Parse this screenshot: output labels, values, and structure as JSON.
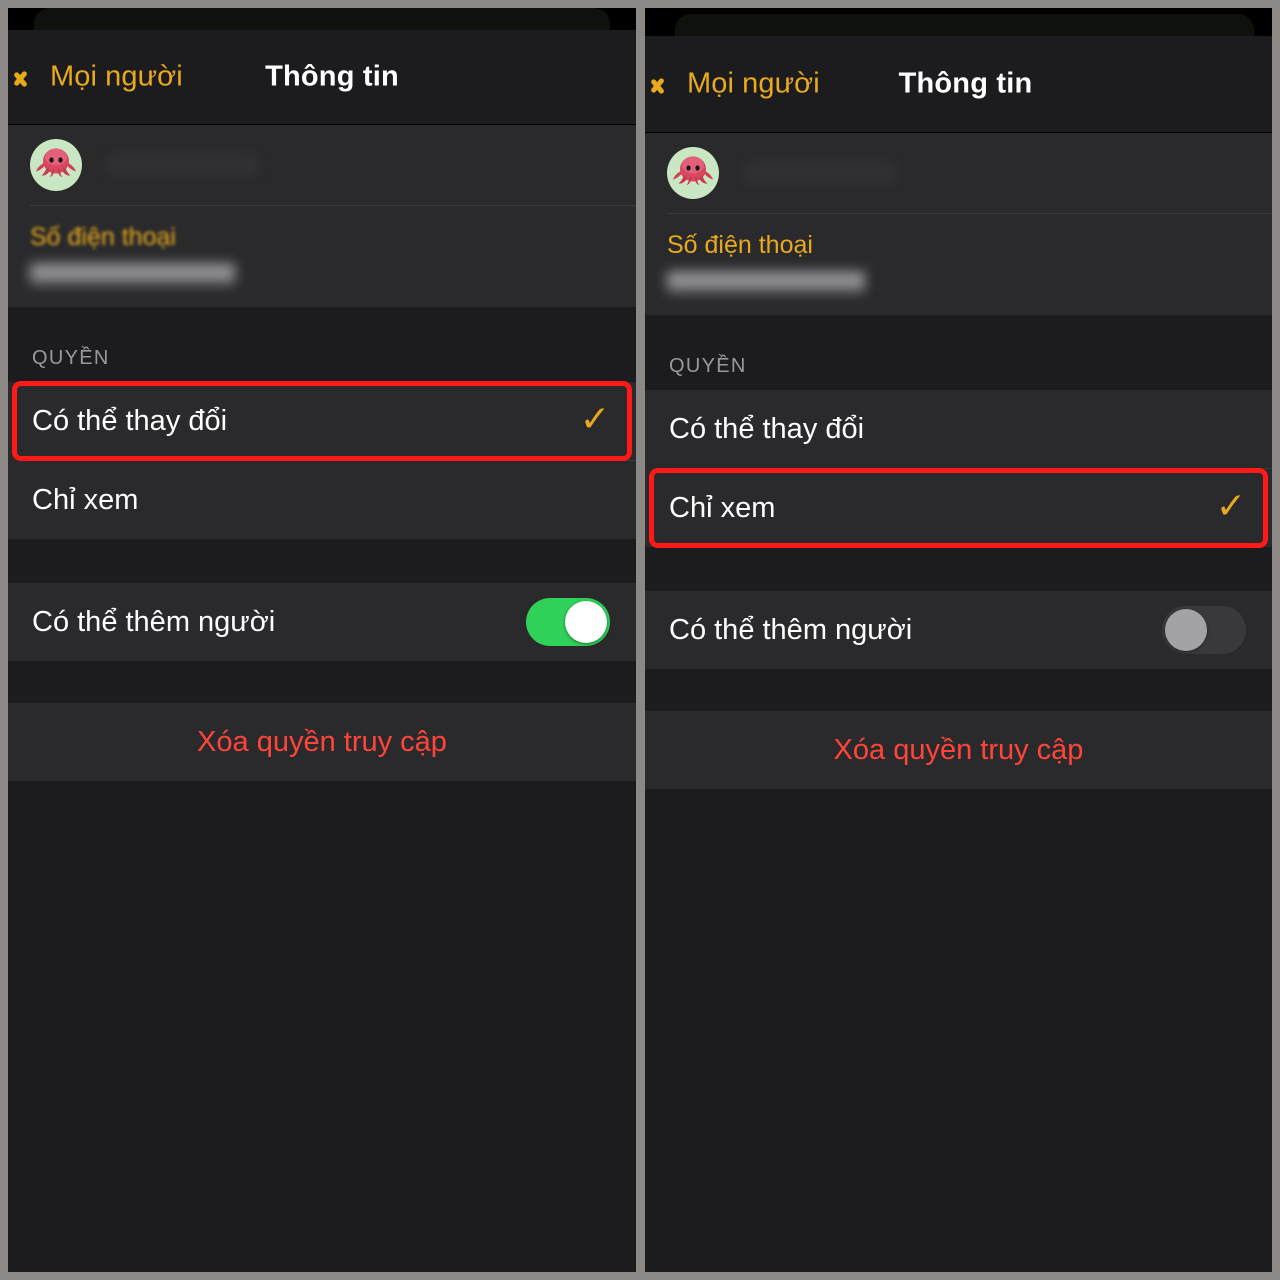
{
  "meta": {
    "background_color": "#8b8885",
    "panel_background": "#1c1c1e",
    "group_background": "#2a2a2c",
    "accent_color": "#e8a91d",
    "highlight_color": "#ff1a17",
    "destructive_color": "#ff453a",
    "toggle_on_color": "#30d158",
    "toggle_off_color": "#39393c"
  },
  "panels": [
    {
      "id": "left",
      "nav": {
        "back_label": "Mọi người",
        "back_icon": "chevron-left-icon",
        "title": "Thông tin"
      },
      "contact": {
        "avatar_icon": "octopus-avatar",
        "name_redacted": true,
        "phone_label": "Số điện thoại",
        "phone_value_redacted": true
      },
      "permissions": {
        "section_header": "QUYỀN",
        "options": [
          {
            "label": "Có thể thay đổi",
            "checked": true,
            "highlighted": true,
            "check_icon": "checkmark-icon"
          },
          {
            "label": "Chỉ xem",
            "checked": false,
            "highlighted": false,
            "check_icon": "checkmark-icon"
          }
        ]
      },
      "add_people": {
        "label": "Có thể thêm người",
        "toggle_state": "on"
      },
      "destructive": {
        "label": "Xóa quyền truy cập"
      }
    },
    {
      "id": "right",
      "nav": {
        "back_label": "Mọi người",
        "back_icon": "chevron-left-icon",
        "title": "Thông tin"
      },
      "contact": {
        "avatar_icon": "octopus-avatar",
        "name_redacted": true,
        "phone_label": "Số điện thoại",
        "phone_value_redacted": true
      },
      "permissions": {
        "section_header": "QUYỀN",
        "options": [
          {
            "label": "Có thể thay đổi",
            "checked": false,
            "highlighted": false,
            "check_icon": "checkmark-icon"
          },
          {
            "label": "Chỉ xem",
            "checked": true,
            "highlighted": true,
            "check_icon": "checkmark-icon"
          }
        ]
      },
      "add_people": {
        "label": "Có thể thêm người",
        "toggle_state": "off"
      },
      "destructive": {
        "label": "Xóa quyền truy cập"
      }
    }
  ]
}
